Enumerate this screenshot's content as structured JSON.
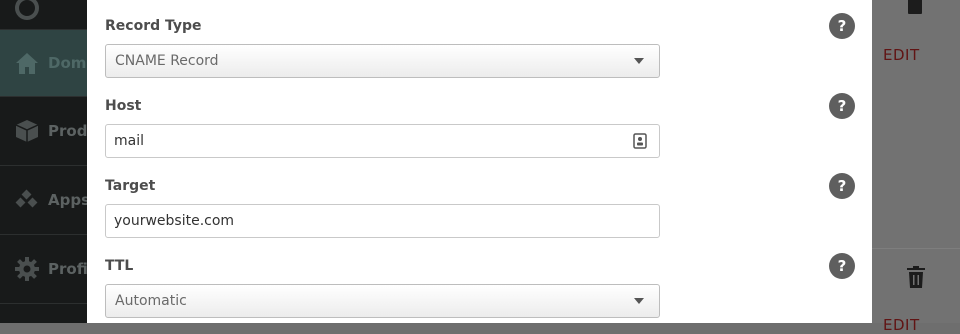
{
  "sidebar": {
    "items": [
      {
        "label": "Domains",
        "icon": "home-icon",
        "active": true
      },
      {
        "label": "Products",
        "icon": "box-icon",
        "active": false
      },
      {
        "label": "Apps",
        "icon": "apps-icon",
        "active": false
      },
      {
        "label": "Profile",
        "icon": "gear-icon",
        "active": false
      }
    ]
  },
  "background": {
    "edit_label": "EDIT"
  },
  "modal": {
    "help_glyph": "?",
    "record_type": {
      "label": "Record Type",
      "value": "CNAME Record"
    },
    "host": {
      "label": "Host",
      "value": "mail"
    },
    "target": {
      "label": "Target",
      "value": "yourwebsite.com"
    },
    "ttl": {
      "label": "TTL",
      "value": "Automatic"
    }
  },
  "colors": {
    "help_button": "#5f5f5f",
    "edit_link": "#611414",
    "sidebar_bg": "#181a1a",
    "sidebar_active": "#2f4443"
  }
}
